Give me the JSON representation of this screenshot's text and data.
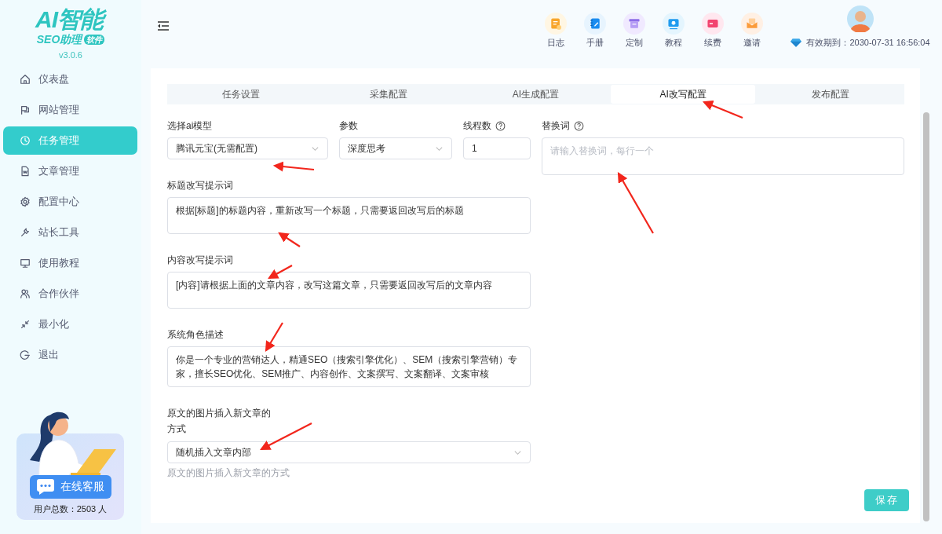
{
  "sidebar": {
    "logo": {
      "title": "AI智能",
      "subtitle": "SEO助理",
      "badge": "软件"
    },
    "version": "v3.0.6",
    "items": [
      {
        "label": "仪表盘",
        "kind": "home",
        "selected": false
      },
      {
        "label": "网站管理",
        "kind": "flag",
        "selected": false
      },
      {
        "label": "任务管理",
        "kind": "clock",
        "selected": true
      },
      {
        "label": "文章管理",
        "kind": "doc",
        "selected": false
      },
      {
        "label": "配置中心",
        "kind": "gear",
        "selected": false
      },
      {
        "label": "站长工具",
        "kind": "wrench",
        "selected": false
      },
      {
        "label": "使用教程",
        "kind": "monitor",
        "selected": false
      },
      {
        "label": "合作伙伴",
        "kind": "people",
        "selected": false
      },
      {
        "label": "最小化",
        "kind": "minimize",
        "selected": false
      },
      {
        "label": "退出",
        "kind": "logout",
        "selected": false
      }
    ],
    "support": {
      "button": "在线客服",
      "users": "用户总数：2503 人"
    }
  },
  "header": {
    "shortcuts": [
      {
        "label": "日志",
        "kind": "log"
      },
      {
        "label": "手册",
        "kind": "manual"
      },
      {
        "label": "定制",
        "kind": "custom"
      },
      {
        "label": "教程",
        "kind": "tutorial"
      },
      {
        "label": "续费",
        "kind": "renew"
      },
      {
        "label": "邀请",
        "kind": "invite"
      }
    ],
    "expiry": "有效期到：2030-07-31 16:56:04"
  },
  "tabs": [
    {
      "label": "任务设置",
      "selected": false
    },
    {
      "label": "采集配置",
      "selected": false
    },
    {
      "label": "AI生成配置",
      "selected": false
    },
    {
      "label": "AI改写配置",
      "selected": true
    },
    {
      "label": "发布配置",
      "selected": false
    }
  ],
  "form": {
    "top_row": [
      {
        "label": "选择ai模型",
        "kind": "select",
        "value": "腾讯元宝(无需配置)",
        "help": false
      },
      {
        "label": "参数",
        "kind": "select",
        "value": "深度思考",
        "help": false
      },
      {
        "label": "线程数",
        "kind": "input",
        "value": "1",
        "help": true
      }
    ],
    "fields": [
      {
        "label": "标题改写提示词",
        "kind": "textarea",
        "value": "根据[标题]的标题内容，重新改写一个标题，只需要返回改写后的标题"
      },
      {
        "label": "内容改写提示词",
        "kind": "textarea",
        "value": "[内容]请根据上面的文章内容，改写这篇文章，只需要返回改写后的文章内容"
      },
      {
        "label": "系统角色描述",
        "kind": "textarea",
        "value": "你是一个专业的营销达人，精通SEO（搜索引擎优化）、SEM（搜索引擎营销）专家，擅长SEO优化、SEM推广、内容创作、文案撰写、文案翻译、文案审核"
      },
      {
        "label": "原文的图片插入新文章的方式",
        "kind": "select",
        "value": "随机插入文章内部",
        "hint": "原文的图片插入新文章的方式"
      }
    ],
    "replace_field": {
      "label": "替换词",
      "help": true,
      "placeholder": "请输入替换词，每行一个"
    },
    "save_button": "保存"
  }
}
